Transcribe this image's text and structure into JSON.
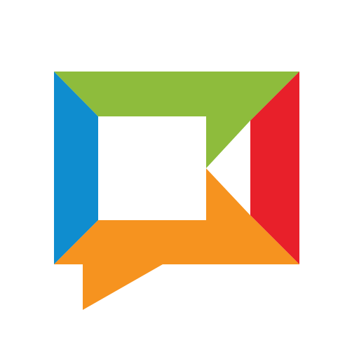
{
  "logo": {
    "icon": "video-chat-bubble-icon",
    "colors": {
      "background": "#ffffff",
      "top_panel": "#8ebc3c",
      "left_panel": "#0f8dcf",
      "right_panel": "#e8202a",
      "bottom_panel": "#f6931f",
      "center_window": "#ffffff"
    }
  }
}
